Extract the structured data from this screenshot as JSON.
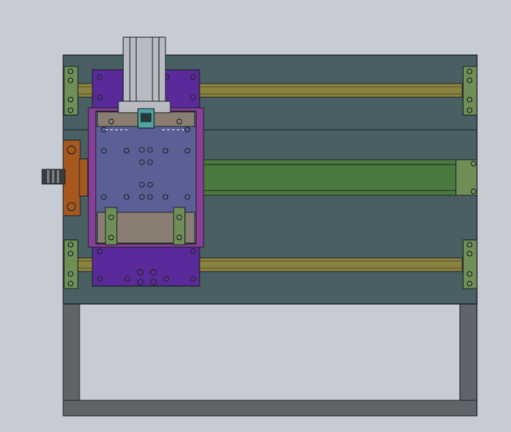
{
  "viewport": {
    "background": "#c7cbd4",
    "description_text": ""
  },
  "colors": {
    "frame_plate": "#4a5f64",
    "frame_outline": "#1e2628",
    "rail": "#8a8240",
    "rail_dark": "#5c5526",
    "bracket": "#6f8f57",
    "purple_carriage": "#5b2a9a",
    "magenta_plate": "#8a3e9a",
    "blue_plate": "#5a5f96",
    "tan_block": "#8a7e72",
    "green_screw": "#4b7a3e",
    "motor_orange": "#a8581f",
    "aluminum": "#b8bcc2",
    "leg_fill": "#5f6468",
    "teal_part": "#4fa3a0"
  },
  "icons": {
    "front_view_icon": "cad-front-view"
  }
}
